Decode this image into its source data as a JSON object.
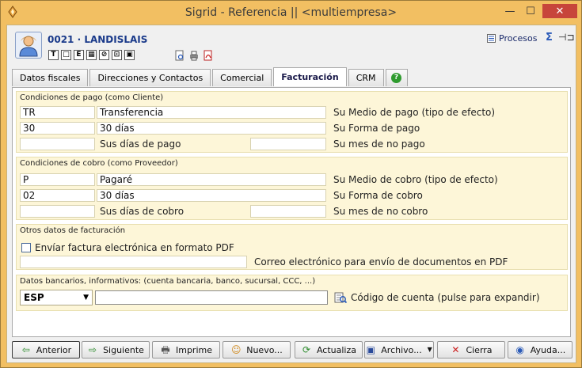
{
  "window": {
    "title": "Sigrid - Referencia || <multiempresa>",
    "minimize_glyph": "—",
    "maximize_glyph": "☐",
    "close_glyph": "✕"
  },
  "header": {
    "client_name": "0021 · LANDISLAIS",
    "procesos_label": "Procesos",
    "format_icons": [
      "T",
      "□",
      "E",
      "▦",
      "⊘",
      "⊡",
      "▣"
    ],
    "action_icons": [
      "preview-icon",
      "print-icon",
      "pdf-icon"
    ]
  },
  "tabs": [
    {
      "label": "Datos fiscales",
      "active": false
    },
    {
      "label": "Direcciones y Contactos",
      "active": false
    },
    {
      "label": "Comercial",
      "active": false
    },
    {
      "label": "Facturación",
      "active": true
    },
    {
      "label": "CRM",
      "active": false
    },
    {
      "label": "?",
      "active": false
    }
  ],
  "pago": {
    "title": "Condiciones de pago (como Cliente)",
    "medio_code": "TR",
    "medio_desc": "Transferencia",
    "medio_label": "Su Medio de pago (tipo de efecto)",
    "forma_code": "30",
    "forma_desc": "30 días",
    "forma_label": "Su Forma de pago",
    "dias_value": "",
    "dias_label": "Sus días de pago",
    "mes_value": "",
    "mes_label": "Su mes de no pago"
  },
  "cobro": {
    "title": "Condiciones de cobro (como Proveedor)",
    "medio_code": "P",
    "medio_desc": "Pagaré",
    "medio_label": "Su Medio de cobro (tipo de efecto)",
    "forma_code": "02",
    "forma_desc": "30 días",
    "forma_label": "Su Forma de cobro",
    "dias_value": "",
    "dias_label": "Sus días de cobro",
    "mes_value": "",
    "mes_label": "Su mes de no cobro"
  },
  "otros": {
    "title": "Otros datos de facturación",
    "checkbox_label": "Envíar factura electrónica en formato PDF",
    "checked": false,
    "email_value": "",
    "email_label": "Correo electrónico para envío de documentos en PDF"
  },
  "bancarios": {
    "title": "Datos bancarios, informativos: (cuenta bancaria, banco, sucursal, CCC, ...)",
    "country": "ESP",
    "account_value": "",
    "account_label": "Código de cuenta (pulse para expandir)"
  },
  "buttons": {
    "anterior": "Anterior",
    "siguiente": "Siguiente",
    "imprime": "Imprime",
    "nuevo": "Nuevo...",
    "actualiza": "Actualiza",
    "archivo": "Archivo...",
    "cierra": "Cierra",
    "ayuda": "Ayuda..."
  },
  "colors": {
    "window_frame": "#f2bf62",
    "section_bg": "#fdf6d8",
    "accent_text": "#1a3a8a",
    "close_button": "#c7453b"
  }
}
